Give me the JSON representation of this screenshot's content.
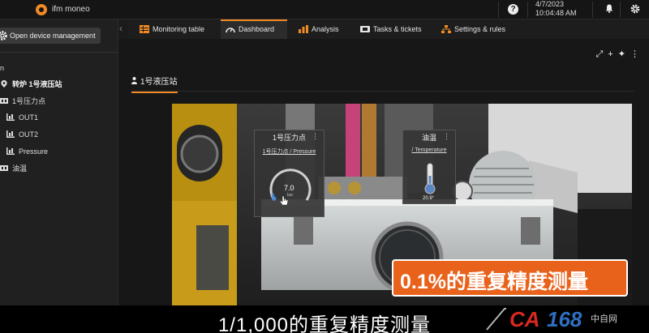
{
  "topbar": {
    "app_name": "ifm moneo",
    "date": "4/7/2023",
    "time": "10:04:48 AM",
    "help_icon": "question-circle-icon",
    "bell_icon": "bell-icon",
    "settings_icon": "gear-icon"
  },
  "sidebar": {
    "open_device_management": "Open device management",
    "tree": [
      {
        "label": "n"
      },
      {
        "label": "转炉 1号液压站"
      },
      {
        "label": "1号压力点"
      },
      {
        "label": "OUT1"
      },
      {
        "label": "OUT2"
      },
      {
        "label": "Pressure"
      },
      {
        "label": "油温"
      }
    ]
  },
  "tabs": [
    {
      "label": "Monitoring table",
      "icon": "table-icon"
    },
    {
      "label": "Dashboard",
      "icon": "gauge-icon",
      "active": true
    },
    {
      "label": "Analysis",
      "icon": "chart-icon"
    },
    {
      "label": "Tasks & tickets",
      "icon": "tickets-icon"
    },
    {
      "label": "Settings & rules",
      "icon": "sitemap-icon"
    }
  ],
  "dashboard": {
    "page_tab": "1号液压站",
    "tools": [
      "expand-icon",
      "plus-icon",
      "pin-icon",
      "more-icon"
    ],
    "widgets": [
      {
        "title": "1号压力点",
        "subtitle": "1号压力点 / Pressure",
        "value": "7.0",
        "unit": "bar"
      },
      {
        "title": "油温",
        "subtitle": "/ Temperature",
        "value": "20.9°"
      }
    ]
  },
  "overlay": {
    "banner_text": "0.1%的重复精度测量",
    "subtitle_text": "1/1,000的重复精度测量",
    "watermark": "CA168 中自网"
  },
  "colors": {
    "accent": "#f08a24",
    "banner": "#e9621b",
    "watermark_red": "#d9281e"
  }
}
